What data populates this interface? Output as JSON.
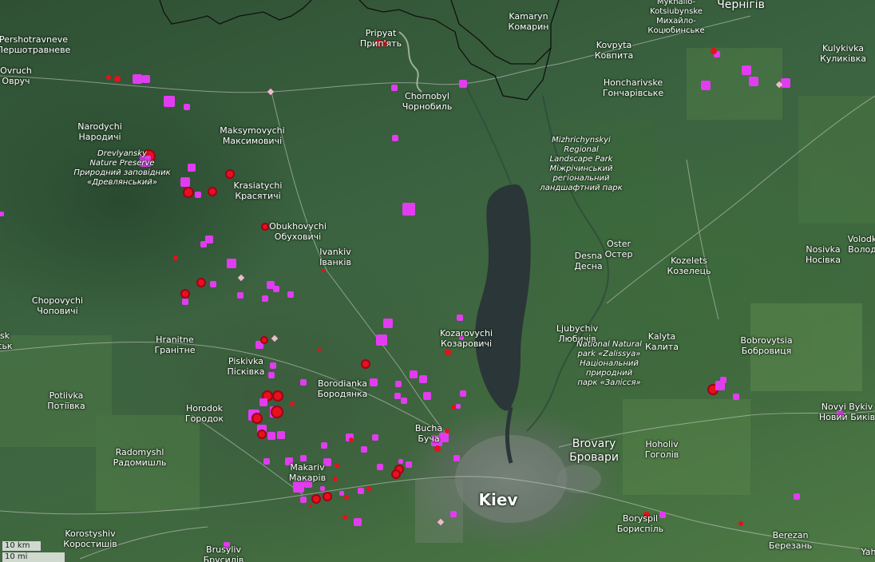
{
  "map": {
    "colors": {
      "reservoir": "#2b3638",
      "border": "#111111",
      "road": "#cfcfcf",
      "hotspot_magenta": "#e23cf0",
      "hotspot_red": "#e8101a",
      "hotspot_darkred": "#a0001a",
      "hotspot_pink": "#f4b8d0"
    },
    "scale": {
      "km": "10 km",
      "mi": "10 mi"
    },
    "places": [
      {
        "lat": "Pershotravneve",
        "cyr": "Першотравневе"
      },
      {
        "lat": "Ovruch",
        "cyr": "Овруч"
      },
      {
        "lat": "Narodychi",
        "cyr": "Народичі"
      },
      {
        "lat": "Pripyat",
        "cyr": "Прип'ять"
      },
      {
        "lat": "Kamaryn",
        "cyr": "Комарин"
      },
      {
        "lat": "Mykhailo-Kotsiubynske",
        "cyr": "Михайло-Коцюбинське"
      },
      {
        "lat": "Chernihiv",
        "cyr": "Чернігів"
      },
      {
        "lat": "Kovpyta",
        "cyr": "Ковпита"
      },
      {
        "lat": "Kulykivka",
        "cyr": "Куликівка"
      },
      {
        "lat": "Chornobyl",
        "cyr": "Чорнобиль"
      },
      {
        "lat": "Honcharivske",
        "cyr": "Гончарівське"
      },
      {
        "lat": "Maksymovychi",
        "cyr": "Максимовичі"
      },
      {
        "lat": "Krasiatychi",
        "cyr": "Красятичі"
      },
      {
        "lat": "Obukhovychi",
        "cyr": "Обуховичі"
      },
      {
        "lat": "Ivankiv",
        "cyr": "Іванків"
      },
      {
        "lat": "Desna",
        "cyr": "Десна"
      },
      {
        "lat": "Oster",
        "cyr": "Остер"
      },
      {
        "lat": "Kozelets",
        "cyr": "Козелець"
      },
      {
        "lat": "Nosivka",
        "cyr": "Носівка"
      },
      {
        "lat": "Volodk",
        "cyr": "Волод"
      },
      {
        "lat": "Chopovychi",
        "cyr": "Чоповичі"
      },
      {
        "lat": "Hranitne",
        "cyr": "Гранітне"
      },
      {
        "lat": "Kozarovychi",
        "cyr": "Козаровичі"
      },
      {
        "lat": "Ljubychiv",
        "cyr": "Любичів"
      },
      {
        "lat": "Kalyta",
        "cyr": "Калита"
      },
      {
        "lat": "Bobrovytsia",
        "cyr": "Бобровиця"
      },
      {
        "lat": "Piskivka",
        "cyr": "Пісківка"
      },
      {
        "lat": "Borodianka",
        "cyr": "Бородянка"
      },
      {
        "lat": "Potiivka",
        "cyr": "Потіївка"
      },
      {
        "lat": "Horodok",
        "cyr": "Городок"
      },
      {
        "lat": "Bucha",
        "cyr": "Буча"
      },
      {
        "lat": "Brovary",
        "cyr": "Бровари"
      },
      {
        "lat": "Hoholiv",
        "cyr": "Гоголів"
      },
      {
        "lat": "Novyi Bykiv",
        "cyr": "Новий Биків"
      },
      {
        "lat": "Radomyshl",
        "cyr": "Радомишль"
      },
      {
        "lat": "Makariv",
        "cyr": "Макарів"
      },
      {
        "lat": "Kiev",
        "cyr": ""
      },
      {
        "lat": "Boryspil",
        "cyr": "Бориспіль"
      },
      {
        "lat": "Korostyshiv",
        "cyr": "Коростишів"
      },
      {
        "lat": "Brusyliv",
        "cyr": "Брусилів"
      },
      {
        "lat": "Berezan",
        "cyr": "Березань"
      },
      {
        "lat": "sk",
        "cyr": "ськ"
      },
      {
        "lat": "Yah",
        "cyr": ""
      }
    ],
    "parks": [
      {
        "lines": [
          "Drevlyansky",
          "Nature Preserve",
          "Природний заповідник",
          "«Древлянський»"
        ]
      },
      {
        "lines": [
          "Mizhrichynskyi",
          "Regional",
          "Landscape Park",
          "Міжрічинський",
          "регіональний",
          "ландшафтний парк"
        ]
      },
      {
        "lines": [
          "National Natural",
          "park «Zalissya»",
          "Національний",
          "природний",
          "парк «Залісся»"
        ]
      }
    ],
    "hotspot_types": [
      "magenta",
      "red",
      "darkred",
      "pink"
    ]
  }
}
